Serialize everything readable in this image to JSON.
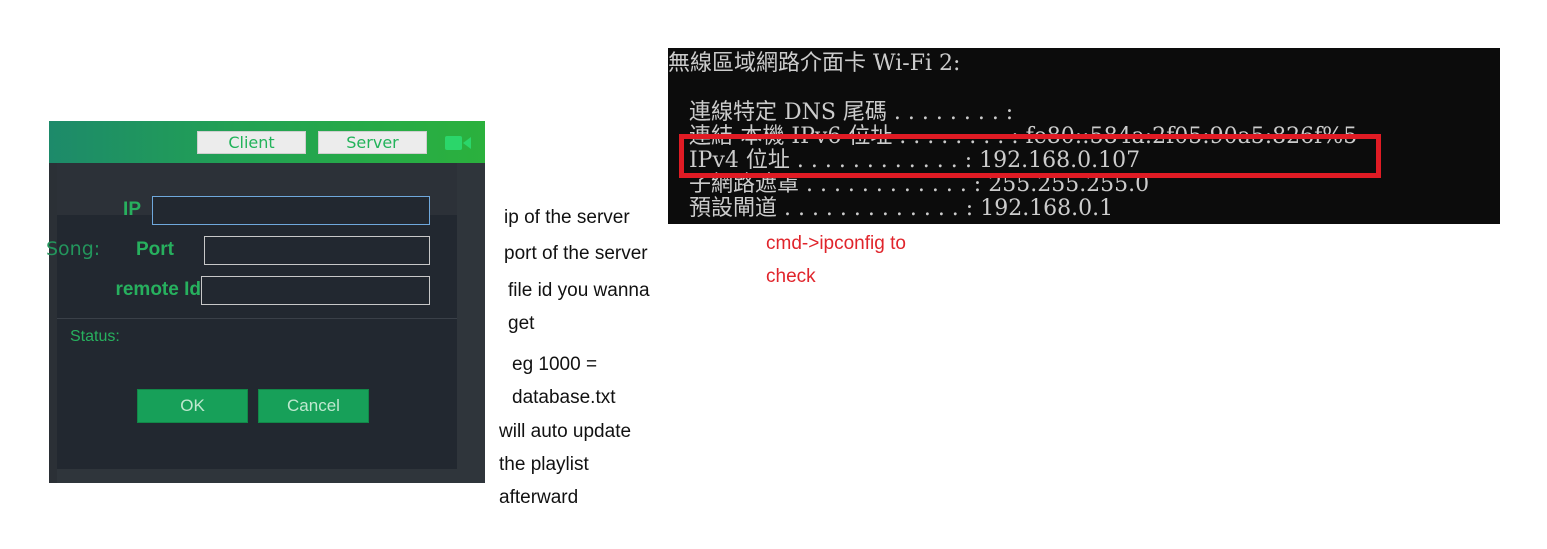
{
  "app": {
    "tabs": {
      "client": "Client",
      "server": "Server"
    },
    "background_label": "Song:",
    "dialog": {
      "ip_label": "IP",
      "port_label": "Port",
      "remote_label": "remote Id",
      "status_label": "Status:",
      "ok_label": "OK",
      "cancel_label": "Cancel",
      "ip_value": "",
      "port_value": "",
      "remote_value": ""
    },
    "colors": {
      "accent": "#27b05e",
      "header_green": "#22a253",
      "dialog_bg": "#222830"
    }
  },
  "notes": {
    "ip": "ip of the server",
    "port": "port of the server",
    "file_line1": "file id you wanna",
    "file_line2": "get",
    "eg_line1": "eg 1000 =",
    "eg_line2": "database.txt",
    "auto_line1": "will auto update",
    "auto_line2": "the playlist",
    "auto_line3": "afterward"
  },
  "terminal": {
    "header": "無線區域網路介面卡 Wi-Fi 2:",
    "lines": [
      "   連線特定 DNS 尾碼 . . . . . . . . :",
      "   連結-本機 IPv6 位址 . . . . . . . . : fe80::584a:2f05:90a5:826f%5",
      "   IPv4 位址 . . . . . . . . . . . . : 192.168.0.107",
      "   子網路遮罩 . . . . . . . . . . . . : 255.255.255.0",
      "   預設閘道 . . . . . . . . . . . . . : 192.168.0.1"
    ],
    "highlight_color": "#e01b24"
  },
  "hint": {
    "line1": "cmd->ipconfig to",
    "line2": "check"
  }
}
